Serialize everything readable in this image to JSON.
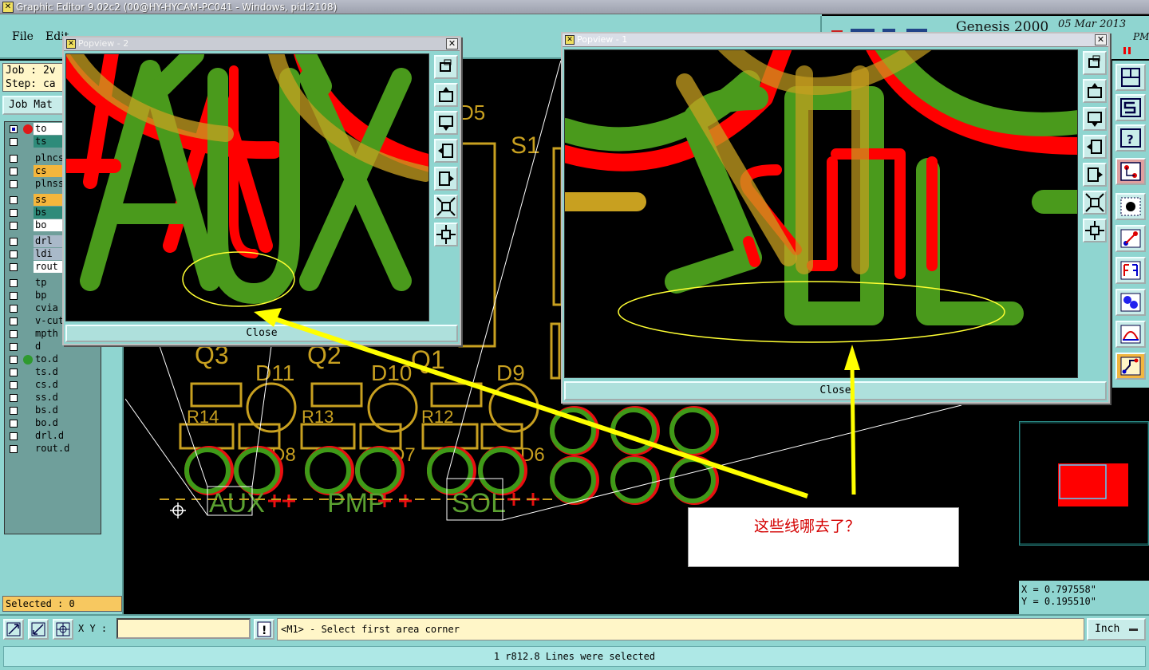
{
  "window": {
    "title": "Graphic Editor 9.02c2 (00@HY-HYCAM-PC041 - Windows, pid:2108)"
  },
  "menu": {
    "items": [
      "File",
      "Edit"
    ]
  },
  "logo": {
    "brand": "Genesis 2000",
    "date": "05 Mar 2013",
    "time": "PM"
  },
  "job": {
    "job_line": "Job : 2v",
    "step_line": "Step: ca",
    "matrix_button": "Job Mat"
  },
  "layers": [
    {
      "name": "to",
      "color": "#ffffff",
      "checked": true,
      "dot": "#e01818"
    },
    {
      "name": "ts",
      "color": "#2e8b7a"
    },
    {
      "name": "plncs",
      "color": "#6f9f9b"
    },
    {
      "name": "cs",
      "color": "#f4b63c"
    },
    {
      "name": "plnss",
      "color": "#6f9f9b"
    },
    {
      "name": "ss",
      "color": "#f4b63c"
    },
    {
      "name": "bs",
      "color": "#2e8b7a"
    },
    {
      "name": "bo",
      "color": "#ffffff"
    },
    {
      "name": "drl",
      "color": "#a9b9c9"
    },
    {
      "name": "ldi",
      "color": "#a9b9c9"
    },
    {
      "name": "rout",
      "color": "#ffffff"
    },
    {
      "name": "tp",
      "color": "#6f9f9b"
    },
    {
      "name": "bp",
      "color": "#6f9f9b"
    },
    {
      "name": "cvia",
      "color": "#6f9f9b"
    },
    {
      "name": "v-cut",
      "color": "#6f9f9b"
    },
    {
      "name": "mpth",
      "color": "#6f9f9b"
    },
    {
      "name": "d",
      "color": "#6f9f9b"
    },
    {
      "name": "to.d",
      "color": "#6f9f9b",
      "dot": "#2f9a2f"
    },
    {
      "name": "ts.d",
      "color": "#6f9f9b"
    },
    {
      "name": "cs.d",
      "color": "#6f9f9b"
    },
    {
      "name": "ss.d",
      "color": "#6f9f9b"
    },
    {
      "name": "bs.d",
      "color": "#6f9f9b"
    },
    {
      "name": "bo.d",
      "color": "#6f9f9b"
    },
    {
      "name": "drl.d",
      "color": "#6f9f9b"
    },
    {
      "name": "rout.d",
      "color": "#6f9f9b"
    }
  ],
  "selected": "Selected : 0",
  "board_labels": {
    "s1": "S1",
    "d5": "D5",
    "q3": "Q3",
    "q2": "Q2",
    "q1": "Q1",
    "d11": "D11",
    "d10": "D10",
    "d9": "D9",
    "r14": "R14",
    "r13": "R13",
    "r12": "R12",
    "d8": "D8",
    "d7": "D7",
    "d6": "D6",
    "aux": "AUX",
    "pmp": "PMP",
    "sol": "SOL"
  },
  "popview2": {
    "title": "Popview - 2",
    "text": "AUX",
    "close_label": "Close"
  },
  "popview1": {
    "title": "Popview - 1",
    "text": "SOL",
    "close_label": "Close"
  },
  "annotation": {
    "text": "这些线哪去了？"
  },
  "coords": {
    "x": "X = 0.797558\"",
    "y": "Y = 0.195510\""
  },
  "bottom": {
    "xy_label": "X Y :",
    "xy_value": "",
    "prompt": "<M1> - Select first area corner",
    "unit": "Inch",
    "status": "1 r812.8 Lines were selected"
  },
  "colors": {
    "panel": "#8fd5d0",
    "trace_green": "#4a9a1c",
    "trace_red": "#ff0000",
    "silk": "#c8a020",
    "highlight": "#ffff00"
  }
}
